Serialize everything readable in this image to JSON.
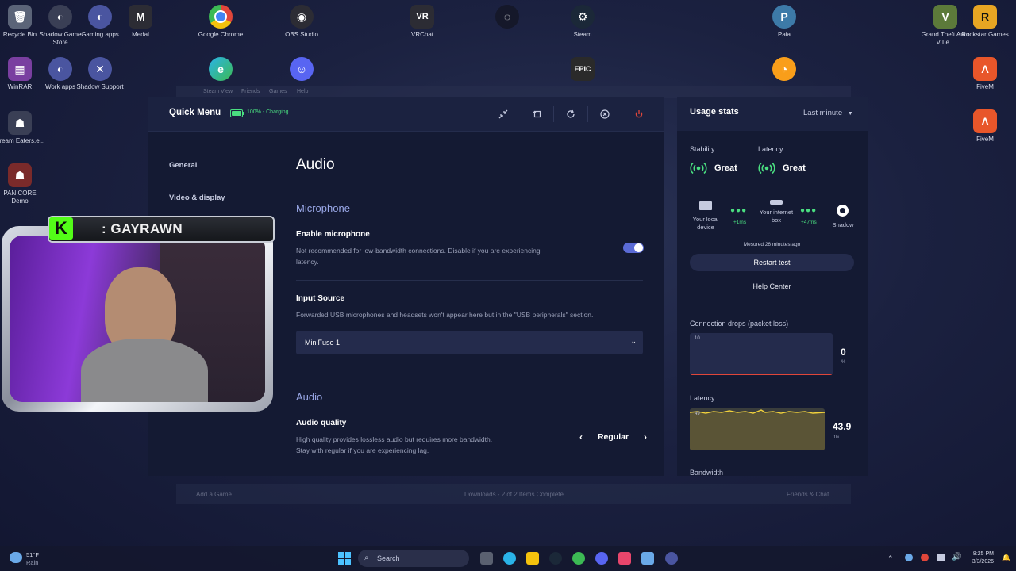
{
  "desktop": {
    "icons": [
      {
        "label": "Recycle Bin",
        "icon": "recycle-bin-icon",
        "color": "#5b6478"
      },
      {
        "label": "Shadow Game Store",
        "icon": "shadow-icon",
        "color": "#3a3f55"
      },
      {
        "label": "Gaming apps",
        "icon": "shadow-icon",
        "color": "#4a55a0"
      },
      {
        "label": "Medal",
        "icon": "medal-icon",
        "color": "#2c2c34"
      },
      {
        "label": "Google Chrome",
        "icon": "chrome-icon",
        "color": "#e0463a"
      },
      {
        "label": "OBS Studio",
        "icon": "obs-icon",
        "color": "#2c2c34"
      },
      {
        "label": "VRChat",
        "icon": "vrchat-icon",
        "color": "#2c2c34"
      },
      {
        "label": "Steam",
        "icon": "steam-icon",
        "color": "#1b2838"
      },
      {
        "label": "Paia",
        "icon": "paia-icon",
        "color": "#3d7aa8"
      },
      {
        "label": "Grand Theft Auto V Le...",
        "icon": "gta-icon",
        "color": "#5c7a3a"
      },
      {
        "label": "Rockstar Games ...",
        "icon": "rockstar-icon",
        "color": "#e8a623"
      },
      {
        "label": "WinRAR",
        "icon": "winrar-icon",
        "color": "#7a3fa0"
      },
      {
        "label": "Work apps",
        "icon": "shadow-icon",
        "color": "#4a55a0"
      },
      {
        "label": "Shadow Support",
        "icon": "support-icon",
        "color": "#4a55a0"
      },
      {
        "label": "FiveM",
        "icon": "fivem-icon",
        "color": "#e8562a"
      },
      {
        "label": "Dream Eaters.e...",
        "icon": "game-icon",
        "color": "#3a3f55"
      },
      {
        "label": "FiveM",
        "icon": "fivem-icon",
        "color": "#e8562a"
      },
      {
        "label": "PANICORE Demo",
        "icon": "game-icon",
        "color": "#7a2a2a"
      }
    ]
  },
  "steam_window": {
    "menu": [
      "Steam",
      "View",
      "Friends",
      "Games",
      "Help"
    ],
    "add_game": "Add a Game",
    "downloads": "Downloads - 2 of 2 Items Complete",
    "friends_chat": "Friends & Chat"
  },
  "quick_menu": {
    "title": "Quick Menu",
    "battery": {
      "text": "100% - Charging",
      "level": 1.0,
      "color": "#4ade80"
    },
    "nav": [
      "General",
      "Video & display"
    ],
    "page_title": "Audio",
    "microphone_section": "Microphone",
    "enable_microphone": {
      "label": "Enable microphone",
      "desc": "Not recommended for low-bandwidth connections. Disable if you are experiencing latency.",
      "on": true
    },
    "input_source": {
      "label": "Input Source",
      "desc": "Forwarded USB microphones and headsets won't appear here but in the \"USB peripherals\" section.",
      "value": "MiniFuse 1"
    },
    "audio_section": "Audio",
    "audio_quality": {
      "label": "Audio quality",
      "desc": "High quality provides lossless audio but requires more bandwidth. Stay with regular if you are experiencing lag.",
      "value": "Regular"
    },
    "accent": "#5b6bd6"
  },
  "usage_stats": {
    "title": "Usage stats",
    "range": "Last minute",
    "stability": {
      "label": "Stability",
      "status": "Great"
    },
    "latency_status": {
      "label": "Latency",
      "status": "Great"
    },
    "path": {
      "local": "Your local device",
      "local_ms": "+1ms",
      "box": "Your internet box",
      "box_ms": "+47ms",
      "shadow": "Shadow"
    },
    "measured": "Mesured 26 minutes ago",
    "restart": "Restart test",
    "help": "Help Center",
    "packet_loss": {
      "label": "Connection drops (packet loss)",
      "axis_max": "10",
      "value": "0",
      "unit": "%"
    },
    "latency_graph": {
      "label": "Latency",
      "axis_max": "49",
      "value": "43.9",
      "unit": "ms"
    },
    "bandwidth_label": "Bandwidth",
    "good_color": "#4ade80"
  },
  "webcam": {
    "name": ": GAYRAWN",
    "logo": "K"
  },
  "taskbar": {
    "weather_temp": "51°F",
    "weather_cond": "Rain",
    "search_placeholder": "Search",
    "time": "8:25 PM",
    "date": "3/3/2026"
  }
}
